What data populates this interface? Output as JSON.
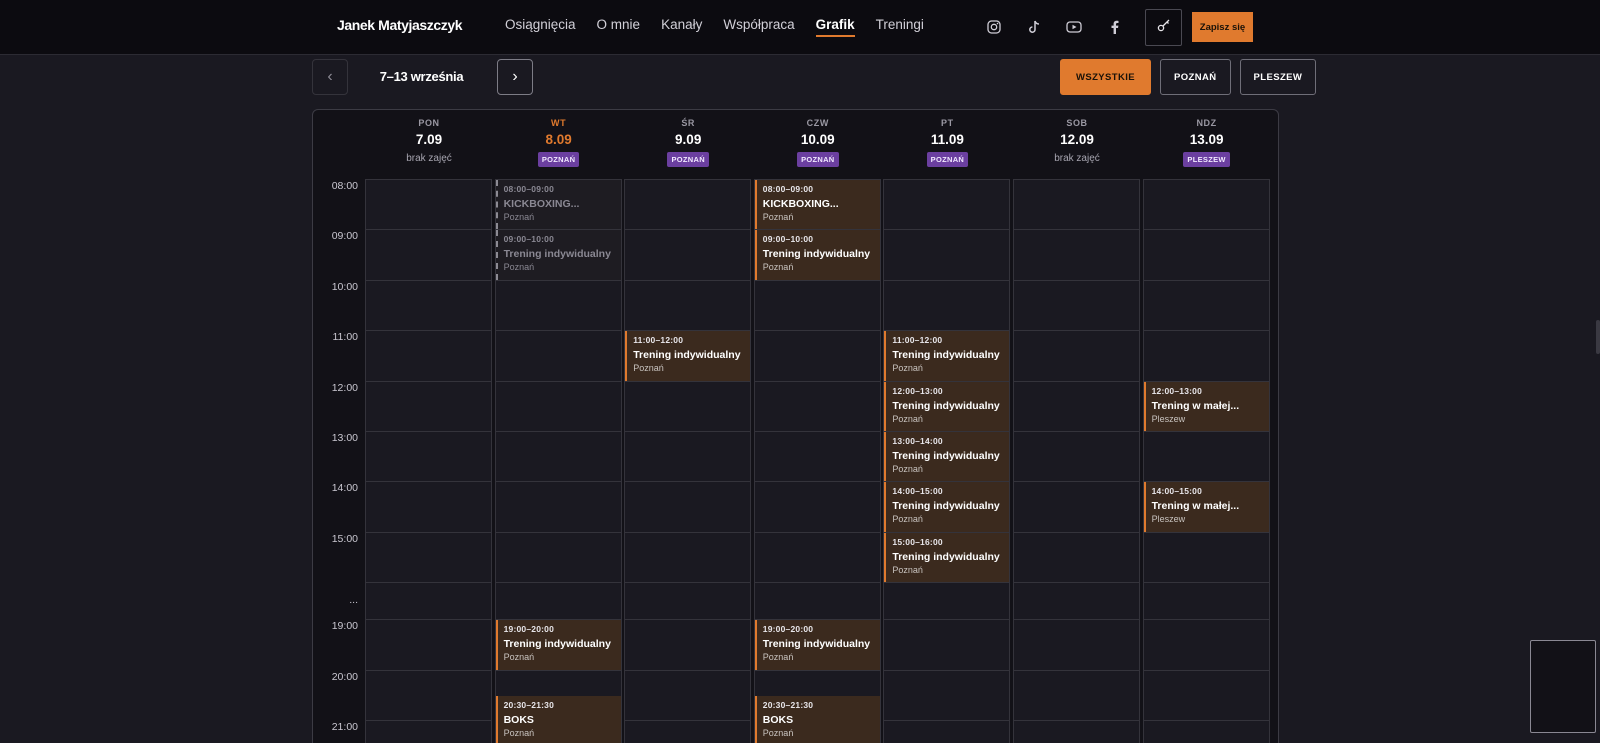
{
  "brand": "Janek Matyjaszczyk",
  "nav": [
    {
      "label": "Osiągnięcia",
      "active": false
    },
    {
      "label": "O mnie",
      "active": false
    },
    {
      "label": "Kanały",
      "active": false
    },
    {
      "label": "Współpraca",
      "active": false
    },
    {
      "label": "Grafik",
      "active": true
    },
    {
      "label": "Treningi",
      "active": false
    }
  ],
  "social": [
    "instagram-icon",
    "tiktok-icon",
    "youtube-icon",
    "facebook-icon"
  ],
  "signup_label": "Zapisz się",
  "week": {
    "prev": "‹",
    "next": "›",
    "label": "7–13 września"
  },
  "filters": [
    {
      "label": "WSZYSTKIE",
      "active": true
    },
    {
      "label": "POZNAŃ",
      "active": false
    },
    {
      "label": "PLESZEW",
      "active": false
    }
  ],
  "colors": {
    "accent": "#e07a2e",
    "badge": "#6b3fa0"
  },
  "days": [
    {
      "abbr": "PON",
      "date": "7.09",
      "note": "brak zajęć",
      "badge": "",
      "today": false
    },
    {
      "abbr": "WT",
      "date": "8.09",
      "note": "",
      "badge": "POZNAŃ",
      "today": true
    },
    {
      "abbr": "ŚR",
      "date": "9.09",
      "note": "",
      "badge": "POZNAŃ",
      "today": false
    },
    {
      "abbr": "CZW",
      "date": "10.09",
      "note": "",
      "badge": "POZNAŃ",
      "today": false
    },
    {
      "abbr": "PT",
      "date": "11.09",
      "note": "",
      "badge": "POZNAŃ",
      "today": false
    },
    {
      "abbr": "SOB",
      "date": "12.09",
      "note": "brak zajęć",
      "badge": "",
      "today": false
    },
    {
      "abbr": "NDZ",
      "date": "13.09",
      "note": "",
      "badge": "PLESZEW",
      "today": false
    }
  ],
  "times": [
    "08:00",
    "09:00",
    "10:00",
    "11:00",
    "12:00",
    "13:00",
    "14:00",
    "15:00",
    "...",
    "19:00",
    "20:00",
    "21:00"
  ],
  "events": [
    {
      "day": 1,
      "row": 0,
      "time": "08:00–09:00",
      "name": "KICKBOXING...",
      "city": "Poznań",
      "past": true
    },
    {
      "day": 1,
      "row": 1,
      "time": "09:00–10:00",
      "name": "Trening indywidualny",
      "city": "Poznań",
      "past": true
    },
    {
      "day": 3,
      "row": 0,
      "time": "08:00–09:00",
      "name": "KICKBOXING...",
      "city": "Poznań",
      "past": false
    },
    {
      "day": 3,
      "row": 1,
      "time": "09:00–10:00",
      "name": "Trening indywidualny",
      "city": "Poznań",
      "past": false
    },
    {
      "day": 2,
      "row": 3,
      "time": "11:00–12:00",
      "name": "Trening indywidualny",
      "city": "Poznań",
      "past": false
    },
    {
      "day": 4,
      "row": 3,
      "time": "11:00–12:00",
      "name": "Trening indywidualny",
      "city": "Poznań",
      "past": false
    },
    {
      "day": 4,
      "row": 4,
      "time": "12:00–13:00",
      "name": "Trening indywidualny",
      "city": "Poznań",
      "past": false
    },
    {
      "day": 4,
      "row": 5,
      "time": "13:00–14:00",
      "name": "Trening indywidualny",
      "city": "Poznań",
      "past": false
    },
    {
      "day": 4,
      "row": 6,
      "time": "14:00–15:00",
      "name": "Trening indywidualny",
      "city": "Poznań",
      "past": false
    },
    {
      "day": 4,
      "row": 7,
      "time": "15:00–16:00",
      "name": "Trening indywidualny",
      "city": "Poznań",
      "past": false
    },
    {
      "day": 6,
      "row": 4,
      "time": "12:00–13:00",
      "name": "Trening w małej...",
      "city": "Pleszew",
      "past": false
    },
    {
      "day": 6,
      "row": 6,
      "time": "14:00–15:00",
      "name": "Trening w małej...",
      "city": "Pleszew",
      "past": false
    },
    {
      "day": 1,
      "row": 9,
      "time": "19:00–20:00",
      "name": "Trening indywidualny",
      "city": "Poznań",
      "past": false
    },
    {
      "day": 3,
      "row": 9,
      "time": "19:00–20:00",
      "name": "Trening indywidualny",
      "city": "Poznań",
      "past": false
    },
    {
      "day": 1,
      "row": 10.5,
      "time": "20:30–21:30",
      "name": "BOKS",
      "city": "Poznań",
      "past": false
    },
    {
      "day": 3,
      "row": 10.5,
      "time": "20:30–21:30",
      "name": "BOKS",
      "city": "Poznań",
      "past": false
    }
  ]
}
